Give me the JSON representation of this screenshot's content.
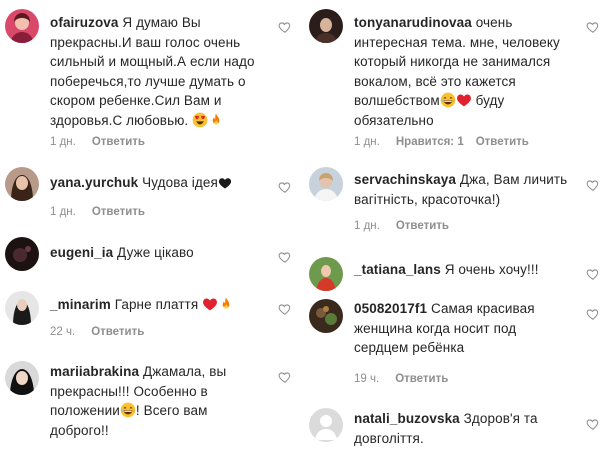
{
  "colors": {
    "meta": "#8e8e8e",
    "text": "#262626",
    "red_heart": "#e0222f",
    "flame": "#f57c00"
  },
  "left": [
    {
      "username": "ofairuzova",
      "text_lines": [
        "Я думаю Вы",
        "прекрасны.И ваш голос очень",
        "сильный и мощный.А если надо",
        "поберечься,то лучше думать о",
        "скором ребенке.Сил Вам и",
        "здоровья.С любовью."
      ],
      "emojis": [
        "heart-eyes-emoji",
        "fire-emoji"
      ],
      "time": "1 дн.",
      "reply": "Ответить"
    },
    {
      "username": "yana.yurchuk",
      "text_lines": [
        "Чудова ідея"
      ],
      "emojis": [
        "black-heart-emoji"
      ],
      "time": "1 дн.",
      "reply": "Ответить"
    },
    {
      "username": "eugeni_ia",
      "text_lines": [
        "Дуже цікаво"
      ],
      "emojis": []
    },
    {
      "username": "_minarim",
      "text_lines": [
        "Гарне плаття"
      ],
      "emojis": [
        "red-heart-emoji",
        "fire-emoji"
      ],
      "time": "22 ч.",
      "reply": "Ответить"
    },
    {
      "username": "mariiabrakina",
      "text_lines": [
        "Джамала, вы",
        "прекрасны!!! Особенно в",
        "положении",
        "! Всего вам",
        "доброго!!"
      ],
      "emojis": [
        "grinning-emoji"
      ]
    }
  ],
  "right": [
    {
      "username": "tonyanarudinovaa",
      "text_lines": [
        "очень",
        "интересная тема. мне, человеку",
        "который никогда не занимался",
        "вокалом, всё это кажется",
        "волшебством",
        "буду",
        "обязательно"
      ],
      "emojis": [
        "grinning-emoji",
        "red-heart-emoji"
      ],
      "time": "1 дн.",
      "likes": "Нравится: 1",
      "reply": "Ответить"
    },
    {
      "username": "servachinskaya",
      "text_lines": [
        "Джа, Вам личить",
        "вагітність, красоточка!)"
      ],
      "emojis": [],
      "time": "1 дн.",
      "reply": "Ответить"
    },
    {
      "username": "_tatiana_lans",
      "text_lines": [
        "Я очень хочу!!!"
      ],
      "emojis": []
    },
    {
      "username": "05082017f1",
      "text_lines": [
        "Самая красивая",
        "женщина когда носит под",
        "сердцем ребёнка"
      ],
      "emojis": [],
      "time": "19 ч.",
      "reply": "Ответить"
    },
    {
      "username": "natali_buzovska",
      "text_lines": [
        "Здоров'я та",
        "довголіття."
      ],
      "emojis": []
    }
  ]
}
